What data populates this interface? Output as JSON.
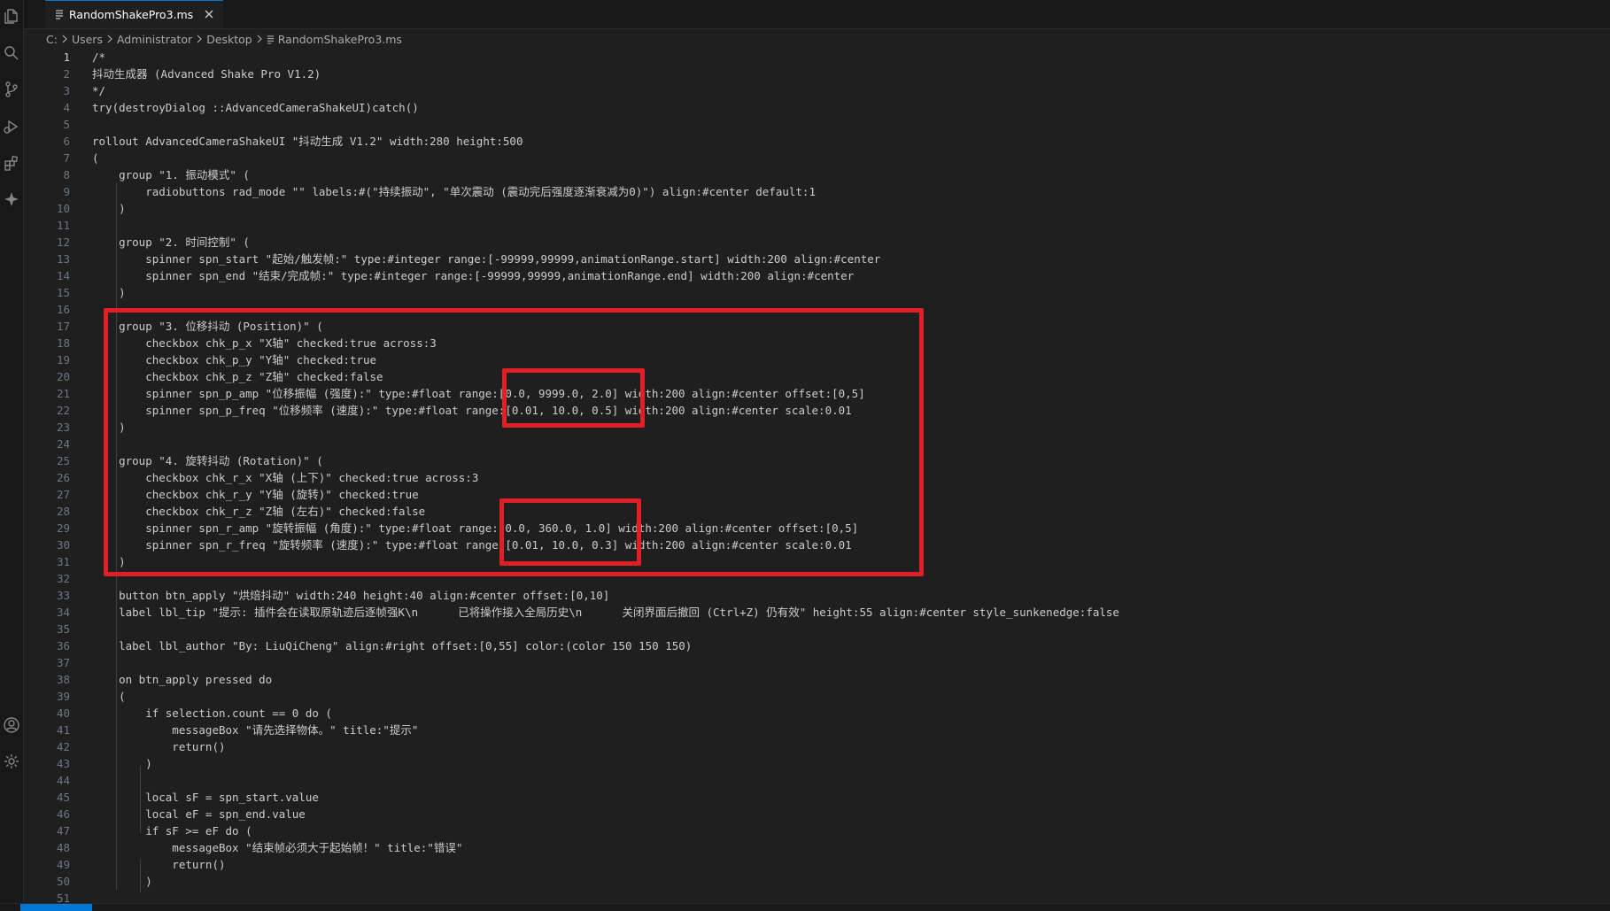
{
  "tab": {
    "filename": "RandomShakePro3.ms"
  },
  "breadcrumb": [
    "C:",
    "Users",
    "Administrator",
    "Desktop",
    "RandomShakePro3.ms"
  ],
  "activity_icons": [
    "files-icon",
    "search-icon",
    "source-control-icon",
    "run-debug-icon",
    "extensions-icon",
    "copilot-icon",
    "account-icon",
    "settings-gear-icon"
  ],
  "code": [
    {
      "n": "1",
      "t": "/*"
    },
    {
      "n": "2",
      "t": "抖动生成器 (Advanced Shake Pro V1.2)"
    },
    {
      "n": "3",
      "t": "*/"
    },
    {
      "n": "4",
      "t": "try(destroyDialog ::AdvancedCameraShakeUI)catch()"
    },
    {
      "n": "5",
      "t": ""
    },
    {
      "n": "6",
      "t": "rollout AdvancedCameraShakeUI \"抖动生成 V1.2\" width:280 height:500"
    },
    {
      "n": "7",
      "t": "("
    },
    {
      "n": "8",
      "t": "    group \"1. 振动模式\" ("
    },
    {
      "n": "9",
      "t": "        radiobuttons rad_mode \"\" labels:#(\"持续振动\", \"单次震动 (震动完后强度逐渐衰减为0)\") align:#center default:1"
    },
    {
      "n": "10",
      "t": "    )"
    },
    {
      "n": "11",
      "t": ""
    },
    {
      "n": "12",
      "t": "    group \"2. 时间控制\" ("
    },
    {
      "n": "13",
      "t": "        spinner spn_start \"起始/触发帧:\" type:#integer range:[-99999,99999,animationRange.start] width:200 align:#center"
    },
    {
      "n": "14",
      "t": "        spinner spn_end \"结束/完成帧:\" type:#integer range:[-99999,99999,animationRange.end] width:200 align:#center"
    },
    {
      "n": "15",
      "t": "    )"
    },
    {
      "n": "16",
      "t": ""
    },
    {
      "n": "17",
      "t": "    group \"3. 位移抖动 (Position)\" ("
    },
    {
      "n": "18",
      "t": "        checkbox chk_p_x \"X轴\" checked:true across:3"
    },
    {
      "n": "19",
      "t": "        checkbox chk_p_y \"Y轴\" checked:true"
    },
    {
      "n": "20",
      "t": "        checkbox chk_p_z \"Z轴\" checked:false"
    },
    {
      "n": "21",
      "t": "        spinner spn_p_amp \"位移振幅 (强度):\" type:#float range:[0.0, 9999.0, 2.0] width:200 align:#center offset:[0,5]"
    },
    {
      "n": "22",
      "t": "        spinner spn_p_freq \"位移频率 (速度):\" type:#float range:[0.01, 10.0, 0.5] width:200 align:#center scale:0.01"
    },
    {
      "n": "23",
      "t": "    )"
    },
    {
      "n": "24",
      "t": ""
    },
    {
      "n": "25",
      "t": "    group \"4. 旋转抖动 (Rotation)\" ("
    },
    {
      "n": "26",
      "t": "        checkbox chk_r_x \"X轴 (上下)\" checked:true across:3"
    },
    {
      "n": "27",
      "t": "        checkbox chk_r_y \"Y轴 (旋转)\" checked:true"
    },
    {
      "n": "28",
      "t": "        checkbox chk_r_z \"Z轴 (左右)\" checked:false"
    },
    {
      "n": "29",
      "t": "        spinner spn_r_amp \"旋转振幅 (角度):\" type:#float range:[0.0, 360.0, 1.0] width:200 align:#center offset:[0,5]"
    },
    {
      "n": "30",
      "t": "        spinner spn_r_freq \"旋转频率 (速度):\" type:#float range:[0.01, 10.0, 0.3] width:200 align:#center scale:0.01"
    },
    {
      "n": "31",
      "t": "    )"
    },
    {
      "n": "32",
      "t": ""
    },
    {
      "n": "33",
      "t": "    button btn_apply \"烘焙抖动\" width:240 height:40 align:#center offset:[0,10]"
    },
    {
      "n": "34",
      "t": "    label lbl_tip \"提示: 插件会在读取原轨迹后逐帧强K\\n      已将操作接入全局历史\\n      关闭界面后撤回 (Ctrl+Z) 仍有效\" height:55 align:#center style_sunkenedge:false"
    },
    {
      "n": "35",
      "t": ""
    },
    {
      "n": "36",
      "t": "    label lbl_author \"By: LiuQiCheng\" align:#right offset:[0,55] color:(color 150 150 150)"
    },
    {
      "n": "37",
      "t": ""
    },
    {
      "n": "38",
      "t": "    on btn_apply pressed do"
    },
    {
      "n": "39",
      "t": "    ("
    },
    {
      "n": "40",
      "t": "        if selection.count == 0 do ("
    },
    {
      "n": "41",
      "t": "            messageBox \"请先选择物体。\" title:\"提示\""
    },
    {
      "n": "42",
      "t": "            return()"
    },
    {
      "n": "43",
      "t": "        )"
    },
    {
      "n": "44",
      "t": ""
    },
    {
      "n": "45",
      "t": "        local sF = spn_start.value"
    },
    {
      "n": "46",
      "t": "        local eF = spn_end.value"
    },
    {
      "n": "47",
      "t": "        if sF >= eF do ("
    },
    {
      "n": "48",
      "t": "            messageBox \"结束帧必须大于起始帧！\" title:\"错误\""
    },
    {
      "n": "49",
      "t": "            return()"
    },
    {
      "n": "50",
      "t": "        )"
    },
    {
      "n": "51",
      "t": ""
    }
  ],
  "colors": {
    "editor_bg": "#1f1f1f",
    "sidebar_bg": "#181818",
    "accent": "#0078d4",
    "annotation": "#e21f26",
    "line_number": "#6e7681",
    "text": "#cccccc"
  }
}
